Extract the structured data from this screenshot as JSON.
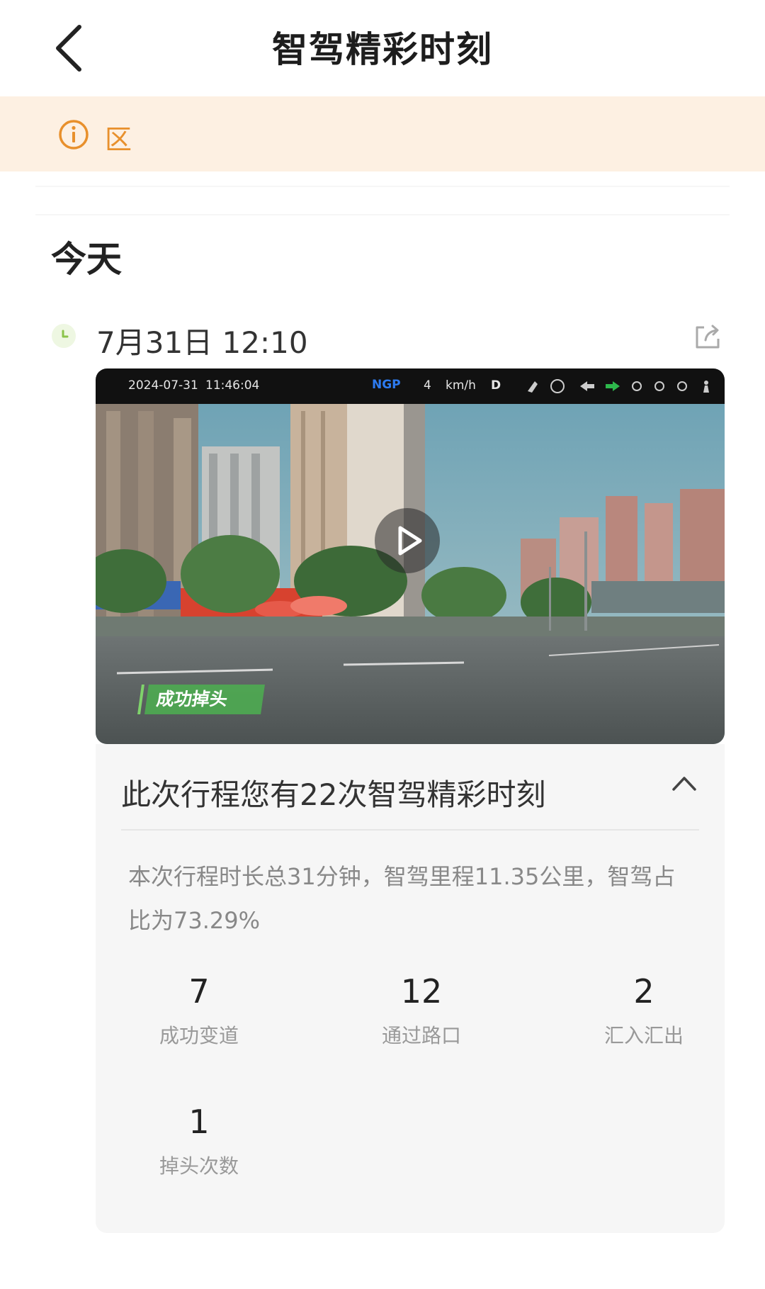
{
  "header": {
    "title": "智驾精彩时刻"
  },
  "notice": {
    "text": "区"
  },
  "section": {
    "title": "今天"
  },
  "trip": {
    "timestamp": "7月31日 12:10",
    "video": {
      "date": "2024-07-31",
      "time": "11:46:04",
      "mode": "NGP",
      "speed": "4",
      "speed_unit": "km/h",
      "gear": "D",
      "tag": "成功掉头"
    },
    "summary": {
      "title": "此次行程您有22次智驾精彩时刻",
      "description": "本次行程时长总31分钟，智驾里程11.35公里，智驾占比为73.29%",
      "stats": [
        {
          "value": "7",
          "label": "成功变道"
        },
        {
          "value": "12",
          "label": "通过路口"
        },
        {
          "value": "2",
          "label": "汇入汇出"
        },
        {
          "value": "1",
          "label": "掉头次数"
        }
      ]
    }
  },
  "colors": {
    "notice_bg": "#fdf0e2",
    "notice_accent": "#e8902c",
    "clock_accent": "#8bc34a",
    "tag_green": "#4caf50"
  }
}
